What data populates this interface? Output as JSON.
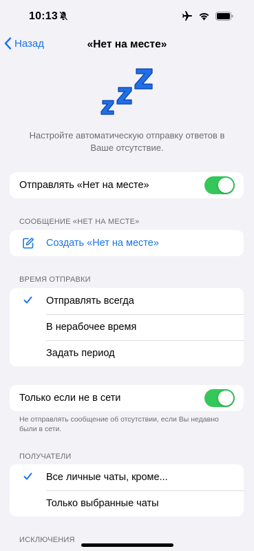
{
  "status_bar": {
    "time": "10:13",
    "icons": [
      "bell-slash-icon",
      "airplane-icon",
      "wifi-icon",
      "battery-icon"
    ]
  },
  "navbar": {
    "back_label": "Назад",
    "title": "«Нет на месте»"
  },
  "intro_text": "Настройте автоматическую отправку ответов в Ваше отсутствие.",
  "away_toggle": {
    "label": "Отправлять «Нет на месте»",
    "enabled": true
  },
  "message_section": {
    "header": "СООБЩЕНИЕ «НЕТ НА МЕСТЕ»",
    "create_label": "Создать «Нет на месте»"
  },
  "schedule_section": {
    "header": "ВРЕМЯ ОТПРАВКИ",
    "options": [
      {
        "label": "Отправлять всегда",
        "selected": true
      },
      {
        "label": "В нерабочее время",
        "selected": false
      },
      {
        "label": "Задать период",
        "selected": false
      }
    ]
  },
  "offline_toggle": {
    "label": "Только если не в сети",
    "enabled": true,
    "note": "Не отправлять сообщение об отсутствии, если Вы недавно были в сети."
  },
  "recipients_section": {
    "header": "ПОЛУЧАТЕЛИ",
    "options": [
      {
        "label": "Все личные чаты, кроме...",
        "selected": true
      },
      {
        "label": "Только выбранные чаты",
        "selected": false
      }
    ]
  },
  "exceptions_section": {
    "header": "ИСКЛЮЧЕНИЯ"
  },
  "colors": {
    "accent": "#1a73e8",
    "toggle_on": "#34c759",
    "zzz": "#1f6fe5"
  }
}
